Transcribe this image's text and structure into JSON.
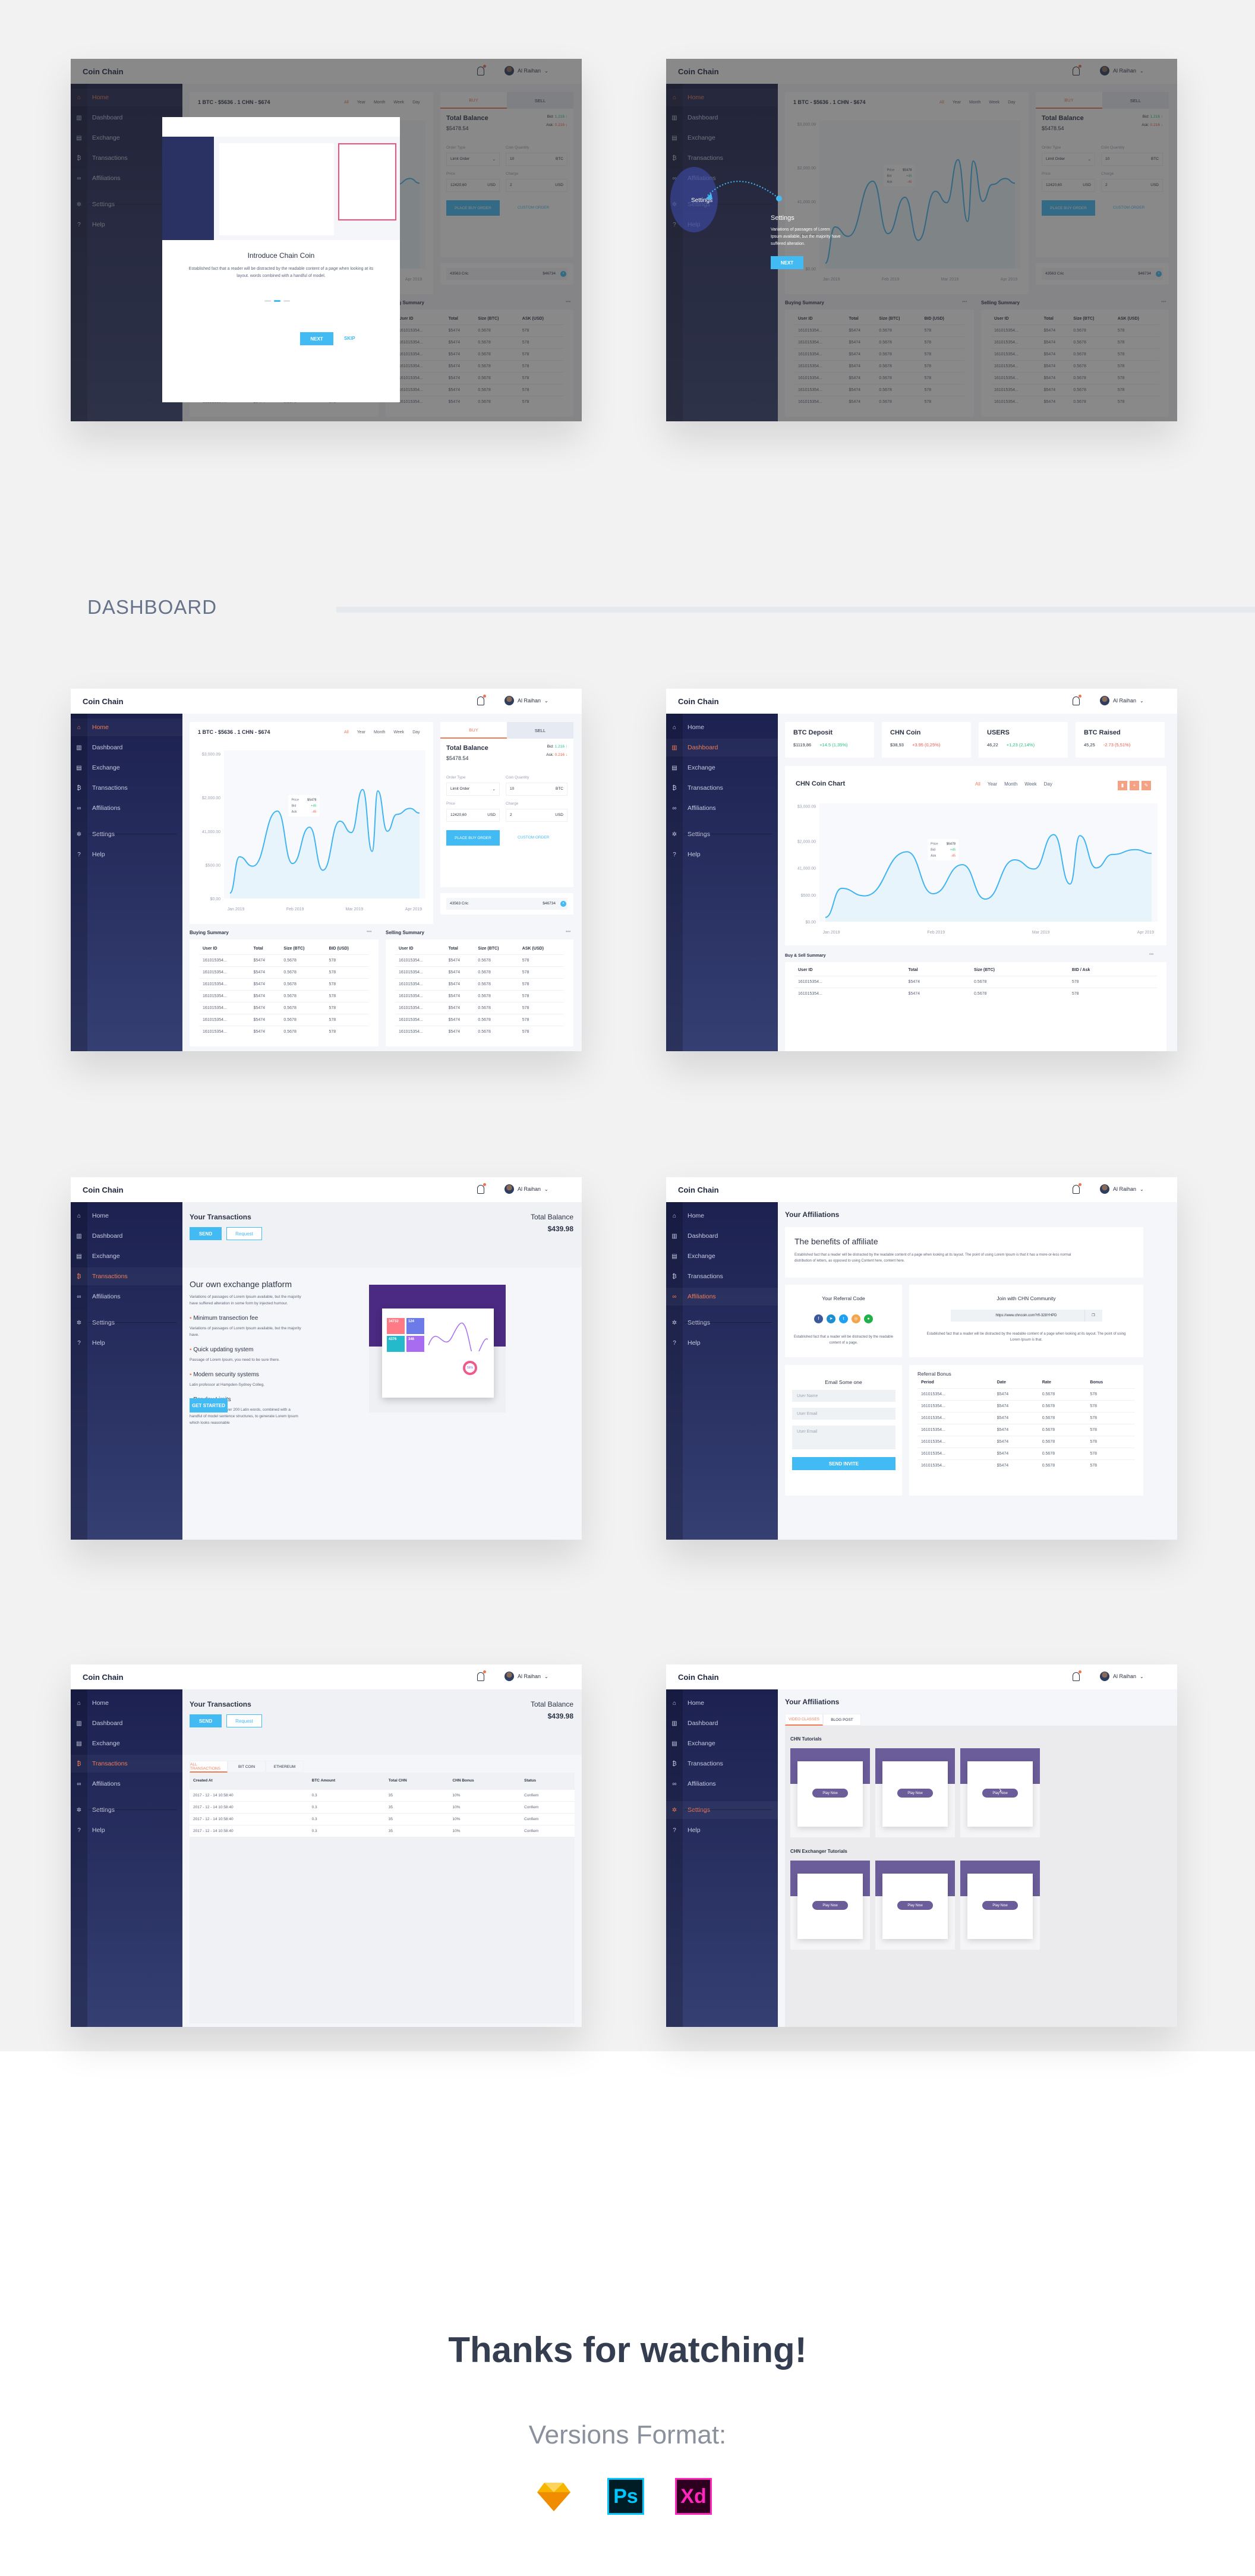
{
  "app": {
    "brand": "Coin Chain",
    "user_name": "Al Raihan",
    "nav": [
      {
        "label": "Home",
        "icon": "home-icon",
        "glyph": "⌂"
      },
      {
        "label": "Dashboard",
        "icon": "bar-chart-icon",
        "glyph": "▥"
      },
      {
        "label": "Exchange",
        "icon": "document-icon",
        "glyph": "▤"
      },
      {
        "label": "Transactions",
        "icon": "bitcoin-icon",
        "glyph": "₿"
      },
      {
        "label": "Affiliations",
        "icon": "link-icon",
        "glyph": "∞"
      },
      {
        "label": "Settings",
        "icon": "gear-icon",
        "glyph": "✲"
      },
      {
        "label": "Help",
        "icon": "help-icon",
        "glyph": "?"
      }
    ]
  },
  "section_label": "DASHBOARD",
  "home": {
    "rate_title": "1 BTC - $5636 . 1 CHN - $674",
    "periods": [
      "All",
      "Year",
      "Month",
      "Week",
      "Day"
    ],
    "active_period": "All",
    "tooltip": {
      "price_label": "Price",
      "price": "$5478",
      "bid_label": "Bid",
      "bid": "+45",
      "ask_label": "Ask",
      "ask": "-45"
    },
    "trade": {
      "tab_buy": "BUY",
      "tab_sell": "SELL",
      "total_balance_label": "Total Balance",
      "total_balance": "$5478.54",
      "bid_label": "Bid:",
      "bid": "1.216 ↑",
      "ask_label": "Ask:",
      "ask": "0.216 ↓",
      "order_type_label": "Order Type",
      "order_type": "Limit Order",
      "coin_qty_label": "Coin Quantity",
      "coin_qty": "10",
      "coin_qty_unit": "BTC",
      "price_label": "Price",
      "price": "12420,60",
      "price_unit": "USD",
      "charge_label": "Charge",
      "charge": "2",
      "charge_unit": "USD",
      "place_order": "PLACE BUY ORDER",
      "custom_order": "CUSTOM ORDER"
    },
    "wallet": {
      "name": "43563 Cric",
      "amount": "$46734"
    },
    "buying": {
      "title": "Buying Summary",
      "columns": [
        "User ID",
        "Total",
        "Size (BTC)",
        "BID (USD)"
      ],
      "rows": [
        [
          "161015354...",
          "$5474",
          "0.5678",
          "578"
        ],
        [
          "161015354...",
          "$5474",
          "0.5678",
          "578"
        ],
        [
          "161015354...",
          "$5474",
          "0.5678",
          "578"
        ],
        [
          "161015354...",
          "$5474",
          "0.5678",
          "578"
        ],
        [
          "161015354...",
          "$5474",
          "0.5678",
          "578"
        ],
        [
          "161015354...",
          "$5474",
          "0.5678",
          "578"
        ],
        [
          "161015354...",
          "$5474",
          "0.5678",
          "578"
        ]
      ]
    },
    "selling": {
      "title": "Selling Summary",
      "columns": [
        "User ID",
        "Total",
        "Size (BTC)",
        "ASK (USD)"
      ],
      "rows": [
        [
          "161015354...",
          "$5474",
          "0.5678",
          "578"
        ],
        [
          "161015354...",
          "$5474",
          "0.5678",
          "578"
        ],
        [
          "161015354...",
          "$5474",
          "0.5678",
          "578"
        ],
        [
          "161015354...",
          "$5474",
          "0.5678",
          "578"
        ],
        [
          "161015354...",
          "$5474",
          "0.5678",
          "578"
        ],
        [
          "161015354...",
          "$5474",
          "0.5678",
          "578"
        ],
        [
          "161015354...",
          "$5474",
          "0.5678",
          "578"
        ]
      ]
    }
  },
  "onboarding_intro": {
    "title": "Introduce Chain Coin",
    "body": "Established fact that a reader will be distracted by the readable content of a page when looking at its layout. words combined with a handful of model.",
    "step": 2,
    "steps": 3,
    "next": "NEXT",
    "skip": "SKIP"
  },
  "onboarding_settings": {
    "title": "Settings",
    "body": "Variations of passages of Lorem Ipsum available, but the majority have suffered alteration.",
    "next": "NEXT"
  },
  "dashboard": {
    "stats": [
      {
        "title": "BTC Deposit",
        "value": "$1119,86",
        "change": "+14.5 (1,35%)",
        "trend": "up"
      },
      {
        "title": "CHN Coin",
        "value": "$38,93",
        "change": "+3.95 (0,25%)",
        "trend": "down"
      },
      {
        "title": "USERS",
        "value": "46,22",
        "change": "+1,23 (2,14%)",
        "trend": "up"
      },
      {
        "title": "BTC Raised",
        "value": "45,25",
        "change": "-2.73 (5,51%)",
        "trend": "down"
      }
    ],
    "chart_title": "CHN Coin Chart",
    "periods": [
      "All",
      "Year",
      "Month",
      "Week",
      "Day"
    ],
    "tools": [
      {
        "icon": "clipboard-icon",
        "glyph": "▮"
      },
      {
        "icon": "plus-icon",
        "glyph": "+"
      },
      {
        "icon": "pencil-icon",
        "glyph": "✎"
      }
    ],
    "summary_title": "Buy & Sell Summary",
    "summary_columns": [
      "User ID",
      "Total",
      "Size (BTC)",
      "BID / Ask"
    ],
    "summary_rows": [
      [
        "161015354...",
        "$5474",
        "0.5678",
        "578"
      ],
      [
        "161015354...",
        "$5474",
        "0.5678",
        "578"
      ]
    ]
  },
  "chart_data": {
    "type": "line",
    "title": "CHN Coin Chart",
    "xlabel": "",
    "ylabel": "",
    "y_tick_labels": [
      "$0.00",
      "$500.00",
      "41,000.00",
      "$2,000.00",
      "$3,000.09"
    ],
    "y_ticks": [
      0,
      500,
      1000,
      2000,
      3000
    ],
    "x_tick_labels": [
      "Jan 2019",
      "Feb 2019",
      "Mar 2019",
      "Apr 2019"
    ],
    "grid": true,
    "series": [
      {
        "name": "CHN",
        "x": [
          0,
          0.05,
          0.12,
          0.25,
          0.33,
          0.42,
          0.49,
          0.58,
          0.64,
          0.7,
          0.75,
          0.78,
          0.83,
          0.88,
          0.95,
          1.0
        ],
        "values": [
          80,
          620,
          480,
          1300,
          520,
          1060,
          420,
          1150,
          980,
          1620,
          700,
          1600,
          1000,
          1250,
          1340,
          1270
        ]
      }
    ]
  },
  "transactions": {
    "title": "Your Transactions",
    "send": "SEND",
    "request": "Request",
    "total_balance_label": "Total Balance",
    "total_balance": "$439.98",
    "promo_title": "Our own exchange platform",
    "promo_body": "Variations of passages of Lorem Ipsum available, but the majority have suffered alteration in some form by injected humour.",
    "features": [
      {
        "title": "Minimum transection fee",
        "body": "Variations of passages of Lorem Ipsum available, but the majority have."
      },
      {
        "title": "Quick updating system",
        "body": "Passage of Lorem Ipsum, you need to be sure there."
      },
      {
        "title": "Modern security systems",
        "body": "Latin professor at Hampden-Sydney Colleg."
      },
      {
        "title": "Per day Limits",
        "body": "Uses a dictionary of over 200 Latin words, combined with a handful of model sentence structures, to generate Lorem Ipsum which looks reasonable"
      }
    ],
    "get_started": "GET STARTED",
    "preview_tiles": [
      "34732",
      "124",
      "4376",
      "346"
    ],
    "preview_donut": "56%",
    "tabs": [
      "ALL TRANSACTIONS",
      "BIT COIN",
      "ETHEREUM"
    ],
    "columns": [
      "Created At",
      "BTC Amount",
      "Total CHN",
      "CHN Bonus",
      "Status"
    ],
    "rows": [
      {
        "created": "2017 - 12 - 14  10:58:40",
        "btc": "0.3",
        "chn": "35",
        "bonus": "10%",
        "status": "Confiem",
        "highlight": true
      },
      {
        "created": "2017 - 12 - 14  10:58:40",
        "btc": "0.3",
        "chn": "35",
        "bonus": "10%",
        "status": "Confiem",
        "highlight": false
      },
      {
        "created": "2017 - 12 - 14  10:58:40",
        "btc": "0.3",
        "chn": "35",
        "bonus": "10%",
        "status": "Confiem",
        "highlight": false
      },
      {
        "created": "2017 - 12 - 14  10:58:40",
        "btc": "0.3",
        "chn": "35",
        "bonus": "10%",
        "status": "Confiem",
        "highlight": true
      }
    ]
  },
  "affiliations": {
    "title": "Your Affiliations",
    "benefits_title": "The benefits of affiliate",
    "benefits_body": "Established fact that a reader will be distracted by the readable content of a page when looking at its layout. The point of using Lorem Ipsum is that it has a more-or-less normal distribution of letters, as opposed to using Content here, content here.",
    "referral_title": "Your Referral Code",
    "socials": [
      {
        "icon": "facebook-icon",
        "glyph": "f",
        "color": "#3b5998"
      },
      {
        "icon": "telegram-icon",
        "glyph": "➤",
        "color": "#1f8ed0"
      },
      {
        "icon": "twitter-icon",
        "glyph": "t",
        "color": "#1da1f2"
      },
      {
        "icon": "instagram-icon",
        "glyph": "◎",
        "color": "#f2a54a"
      },
      {
        "icon": "wechat-icon",
        "glyph": "●",
        "color": "#21b14a"
      }
    ],
    "referral_body": "Established fact that a reader will be distracted by the readable content of a page.",
    "community_title": "Join with CHN Community",
    "community_link": "https://www.chncoin.com?rfl-328YHPD",
    "community_body": "Established fact that a reader will be distracted by the readable content of a page when looking at its layout. The point of using Lorem Ipsum is that.",
    "email_title": "Email Some one",
    "name_placeholder": "User Name",
    "email_placeholder": "User Email",
    "message_placeholder": "User Email",
    "send_invite": "SEND INVITE",
    "bonus_title": "Referral Bonus",
    "bonus_columns": [
      "Period",
      "Date",
      "Rate",
      "Bonus"
    ],
    "bonus_rows": [
      [
        "161015354...",
        "$5474",
        "0.5678",
        "578"
      ],
      [
        "161015354...",
        "$5474",
        "0.5678",
        "578"
      ],
      [
        "161015354...",
        "$5474",
        "0.5678",
        "578"
      ],
      [
        "161015354...",
        "$5474",
        "0.5678",
        "578"
      ],
      [
        "161015354...",
        "$5474",
        "0.5678",
        "578"
      ],
      [
        "161015354...",
        "$5474",
        "0.5678",
        "578"
      ],
      [
        "161015354...",
        "$5474",
        "0.5678",
        "578"
      ]
    ],
    "tabs": [
      "VIDEO CLASSES",
      "BLOG POST"
    ],
    "tutorials_title": "CHN Tutorials",
    "exchanger_title": "CHN Exchanger Tutorials",
    "play_now": "Play Now"
  },
  "footer": {
    "thanks": "Thanks for watching!",
    "versions": "Versions Format:",
    "formats": [
      {
        "icon": "sketch-icon",
        "label": "◆"
      },
      {
        "icon": "photoshop-icon",
        "label": "Ps"
      },
      {
        "icon": "xd-icon",
        "label": "Xd"
      }
    ]
  },
  "colors": {
    "accent": "#f07b56",
    "primary": "#42bbf5",
    "sidebar": "#262c5e",
    "up": "#22c37c",
    "down": "#f0574a"
  }
}
